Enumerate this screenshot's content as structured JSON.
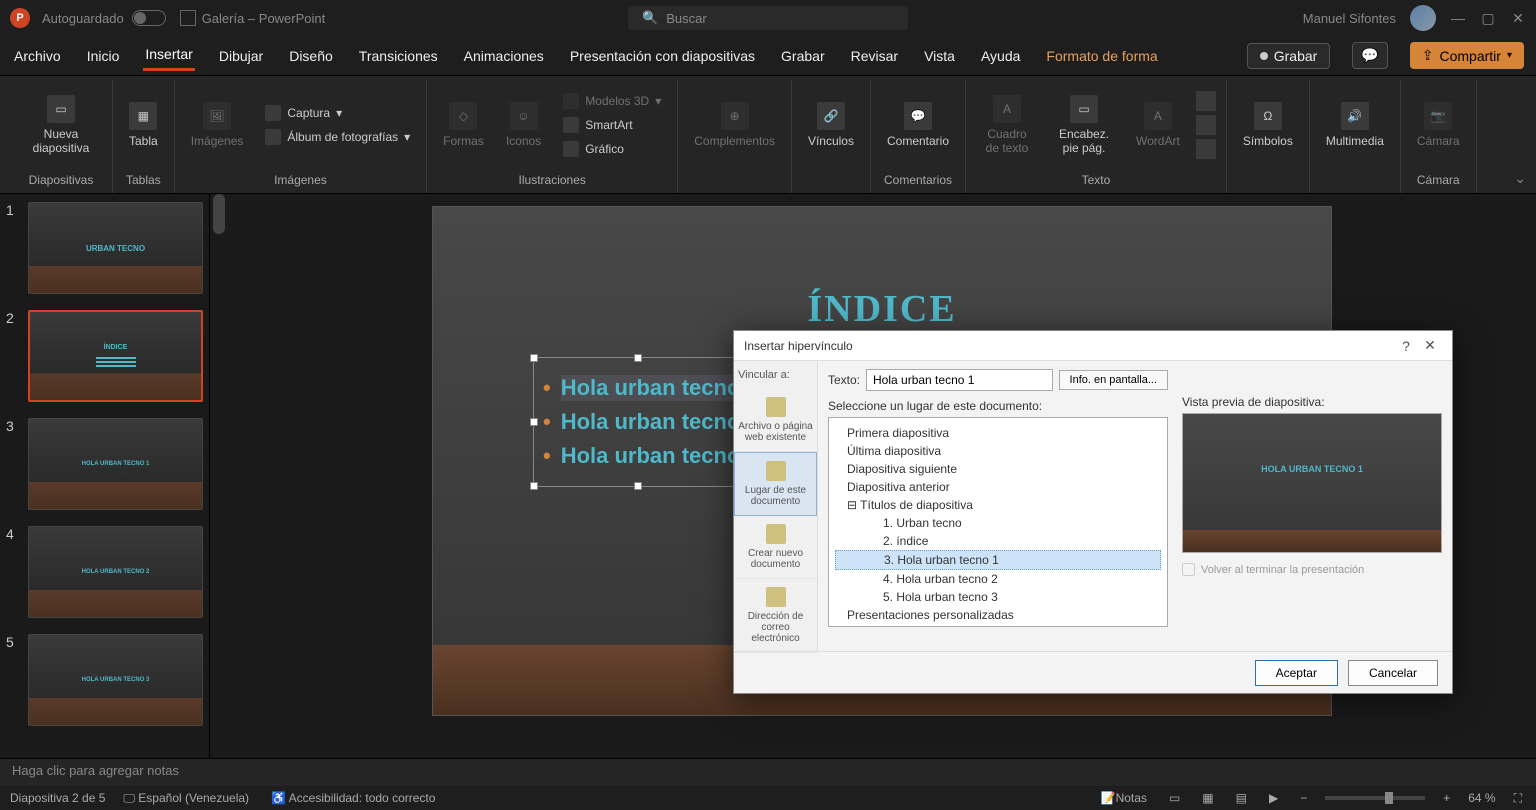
{
  "titlebar": {
    "autosave_label": "Autoguardado",
    "doc_title": "Galería – PowerPoint",
    "search_placeholder": "Buscar",
    "user_name": "Manuel Sifontes"
  },
  "tabs": {
    "archivo": "Archivo",
    "inicio": "Inicio",
    "insertar": "Insertar",
    "dibujar": "Dibujar",
    "diseno": "Diseño",
    "transiciones": "Transiciones",
    "animaciones": "Animaciones",
    "presentacion": "Presentación con diapositivas",
    "grabar": "Grabar",
    "revisar": "Revisar",
    "vista": "Vista",
    "ayuda": "Ayuda",
    "formato_forma": "Formato de forma",
    "record_btn": "Grabar",
    "share_btn": "Compartir"
  },
  "ribbon": {
    "nueva_diapositiva": "Nueva diapositiva",
    "g_diapositivas": "Diapositivas",
    "tabla": "Tabla",
    "g_tablas": "Tablas",
    "imagenes": "Imágenes",
    "captura": "Captura",
    "album": "Álbum de fotografías",
    "g_imagenes": "Imágenes",
    "formas": "Formas",
    "iconos": "Iconos",
    "modelos3d": "Modelos 3D",
    "smartart": "SmartArt",
    "grafico": "Gráfico",
    "g_ilustraciones": "Ilustraciones",
    "complementos": "Complementos",
    "vinculos": "Vínculos",
    "comentario": "Comentario",
    "g_comentarios": "Comentarios",
    "cuadro_texto": "Cuadro de texto",
    "encabez": "Encabez. pie pág.",
    "wordart": "WordArt",
    "g_texto": "Texto",
    "simbolos": "Símbolos",
    "multimedia": "Multimedia",
    "camara": "Cámara",
    "g_camara": "Cámara"
  },
  "thumbs": {
    "t1_title": "URBAN TECNO",
    "t3_text": "HOLA URBAN TECNO 1",
    "t4_text": "HOLA URBAN TECNO 2",
    "t5_text": "HOLA URBAN TECNO 3"
  },
  "slide": {
    "title": "ÍNDICE",
    "item1": "Hola urban tecno 1",
    "item2": "Hola urban tecno 2",
    "item3": "Hola urban tecno 3"
  },
  "notes": {
    "placeholder": "Haga clic para agregar notas"
  },
  "status": {
    "slide_pos": "Diapositiva 2 de 5",
    "lang": "Español (Venezuela)",
    "access": "Accesibilidad: todo correcto",
    "notas": "Notas",
    "zoom": "64 %"
  },
  "dialog": {
    "title": "Insertar hipervínculo",
    "vincular_a": "Vincular a:",
    "texto_label": "Texto:",
    "texto_value": "Hola urban tecno 1",
    "info_btn": "Info. en pantalla...",
    "side_archivo": "Archivo o página web existente",
    "side_lugar": "Lugar de este documento",
    "side_crear": "Crear nuevo documento",
    "side_correo": "Dirección de correo electrónico",
    "seleccione": "Seleccione un lugar de este documento:",
    "tree_primera": "Primera diapositiva",
    "tree_ultima": "Última diapositiva",
    "tree_siguiente": "Diapositiva siguiente",
    "tree_anterior": "Diapositiva anterior",
    "tree_titulos": "Títulos de diapositiva",
    "tree_t1": "1. Urban tecno",
    "tree_t2": "2. índice",
    "tree_t3": "3. Hola urban tecno 1",
    "tree_t4": "4. Hola urban tecno 2",
    "tree_t5": "5. Hola urban tecno 3",
    "tree_pers": "Presentaciones personalizadas",
    "vista_previa": "Vista previa de diapositiva:",
    "preview_text": "HOLA URBAN TECNO 1",
    "volver_check": "Volver al terminar la presentación",
    "aceptar": "Aceptar",
    "cancelar": "Cancelar"
  }
}
